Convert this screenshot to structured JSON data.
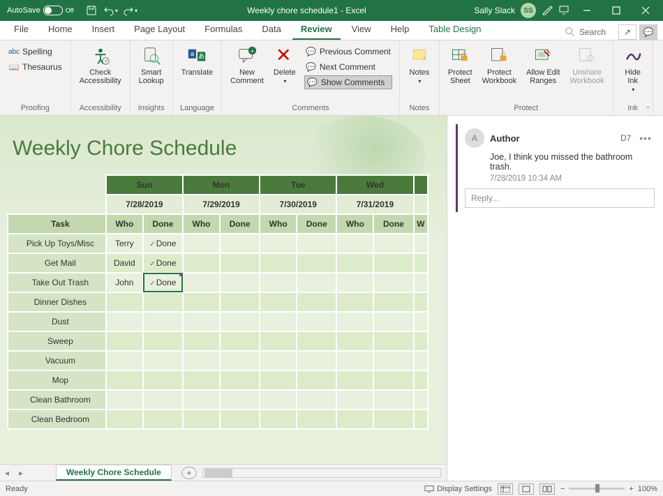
{
  "titlebar": {
    "autosave_label": "AutoSave",
    "autosave_state": "Off",
    "doc_title": "Weekly chore schedule1  -  Excel",
    "user_name": "Sally Slack",
    "user_initials": "SS"
  },
  "tabs": {
    "file": "File",
    "home": "Home",
    "insert": "Insert",
    "pagelayout": "Page Layout",
    "formulas": "Formulas",
    "data": "Data",
    "review": "Review",
    "view": "View",
    "help": "Help",
    "tabledesign": "Table Design",
    "search": "Search"
  },
  "ribbon": {
    "proofing": {
      "spelling": "Spelling",
      "thesaurus": "Thesaurus",
      "label": "Proofing"
    },
    "accessibility": {
      "check": "Check\nAccessibility",
      "label": "Accessibility"
    },
    "insights": {
      "smart": "Smart\nLookup",
      "label": "Insights"
    },
    "language": {
      "translate": "Translate",
      "label": "Language"
    },
    "comments": {
      "new": "New\nComment",
      "delete": "Delete",
      "prev": "Previous Comment",
      "next": "Next Comment",
      "show": "Show Comments",
      "label": "Comments"
    },
    "notes": {
      "notes": "Notes",
      "label": "Notes"
    },
    "protect": {
      "sheet": "Protect\nSheet",
      "workbook": "Protect\nWorkbook",
      "ranges": "Allow Edit\nRanges",
      "unshare": "Unshare\nWorkbook",
      "label": "Protect"
    },
    "ink": {
      "hide": "Hide\nInk",
      "label": "Ink"
    }
  },
  "worksheet": {
    "title": "Weekly Chore Schedule",
    "days": [
      "Sun",
      "Mon",
      "Tue",
      "Wed"
    ],
    "dates": [
      "7/28/2019",
      "7/29/2019",
      "7/30/2019",
      "7/31/2019"
    ],
    "task_header": "Task",
    "who_header": "Who",
    "done_header": "Done",
    "partial_who": "W",
    "tasks": [
      {
        "name": "Pick Up Toys/Misc",
        "who": "Terry",
        "done": "Done"
      },
      {
        "name": "Get Mail",
        "who": "David",
        "done": "Done"
      },
      {
        "name": "Take Out Trash",
        "who": "John",
        "done": "Done"
      },
      {
        "name": "Dinner Dishes",
        "who": "",
        "done": ""
      },
      {
        "name": "Dust",
        "who": "",
        "done": ""
      },
      {
        "name": "Sweep",
        "who": "",
        "done": ""
      },
      {
        "name": "Vacuum",
        "who": "",
        "done": ""
      },
      {
        "name": "Mop",
        "who": "",
        "done": ""
      },
      {
        "name": "Clean Bathroom",
        "who": "",
        "done": ""
      },
      {
        "name": "Clean Bedroom",
        "who": "",
        "done": ""
      }
    ]
  },
  "comment": {
    "author": "Author",
    "cell": "D7",
    "text": "Joe, I think you missed the bathroom trash.",
    "time": "7/28/2019 10:34 AM",
    "reply_placeholder": "Reply...",
    "avatar": "A"
  },
  "sheettab": {
    "name": "Weekly Chore Schedule"
  },
  "status": {
    "ready": "Ready",
    "display": "Display Settings",
    "zoom": "100%"
  }
}
